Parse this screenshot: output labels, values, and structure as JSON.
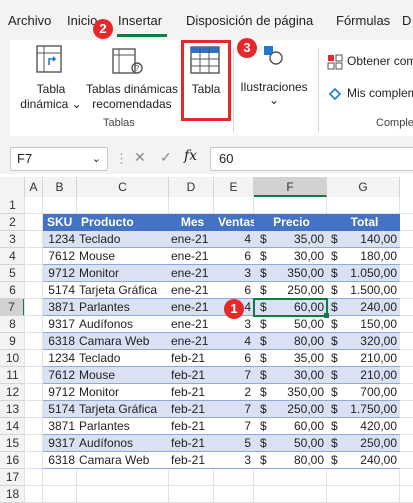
{
  "menu": [
    "Archivo",
    "Inicio",
    "Insertar",
    "Disposición de página",
    "Fórmulas",
    "D"
  ],
  "ribbon": {
    "tabla_dinamica": "Tabla\ndinámica",
    "tablas_recomendadas": "Tablas dinámicas\nrecomendadas",
    "tabla": "Tabla",
    "ilustraciones": "Ilustraciones",
    "obtener": "Obtener com",
    "mis": "Mis complem",
    "group_tablas": "Tablas",
    "group_comple": "Comple"
  },
  "badges": [
    "1",
    "2",
    "3"
  ],
  "formula_bar": {
    "name_box": "F7",
    "fx": "fx",
    "value": "60"
  },
  "columns": [
    "A",
    "B",
    "C",
    "D",
    "E",
    "F",
    "G"
  ],
  "rows": [
    "1",
    "2",
    "3",
    "4",
    "5",
    "6",
    "7",
    "8",
    "9",
    "10",
    "11",
    "12",
    "13",
    "14",
    "15",
    "16",
    "17",
    "18"
  ],
  "table": {
    "headers": [
      "SKU",
      "Producto",
      "Mes",
      "Ventas",
      "Precio",
      "Total"
    ],
    "rows": [
      [
        "1234",
        "Teclado",
        "ene-21",
        "4",
        "$",
        "35,00",
        "$",
        "140,00"
      ],
      [
        "7612",
        "Mouse",
        "ene-21",
        "6",
        "$",
        "30,00",
        "$",
        "180,00"
      ],
      [
        "9712",
        "Monitor",
        "ene-21",
        "3",
        "$",
        "350,00",
        "$",
        "1.050,00"
      ],
      [
        "5174",
        "Tarjeta Gráfica",
        "ene-21",
        "6",
        "$",
        "250,00",
        "$",
        "1.500,00"
      ],
      [
        "3871",
        "Parlantes",
        "ene-21",
        "4",
        "$",
        "60,00",
        "$",
        "240,00"
      ],
      [
        "9317",
        "Audífonos",
        "ene-21",
        "3",
        "$",
        "50,00",
        "$",
        "150,00"
      ],
      [
        "6318",
        "Camara Web",
        "ene-21",
        "4",
        "$",
        "80,00",
        "$",
        "320,00"
      ],
      [
        "1234",
        "Teclado",
        "feb-21",
        "6",
        "$",
        "35,00",
        "$",
        "210,00"
      ],
      [
        "7612",
        "Mouse",
        "feb-21",
        "7",
        "$",
        "30,00",
        "$",
        "210,00"
      ],
      [
        "9712",
        "Monitor",
        "feb-21",
        "2",
        "$",
        "350,00",
        "$",
        "700,00"
      ],
      [
        "5174",
        "Tarjeta Gráfica",
        "feb-21",
        "7",
        "$",
        "250,00",
        "$",
        "1.750,00"
      ],
      [
        "3871",
        "Parlantes",
        "feb-21",
        "7",
        "$",
        "60,00",
        "$",
        "420,00"
      ],
      [
        "9317",
        "Audífonos",
        "feb-21",
        "5",
        "$",
        "50,00",
        "$",
        "250,00"
      ],
      [
        "6318",
        "Camara Web",
        "feb-21",
        "3",
        "$",
        "80,00",
        "$",
        "240,00"
      ]
    ]
  },
  "colors": {
    "accent": "#107c41",
    "header_fill": "#4472c4",
    "band_fill": "#d9e1f2",
    "badge": "#e8272b"
  }
}
